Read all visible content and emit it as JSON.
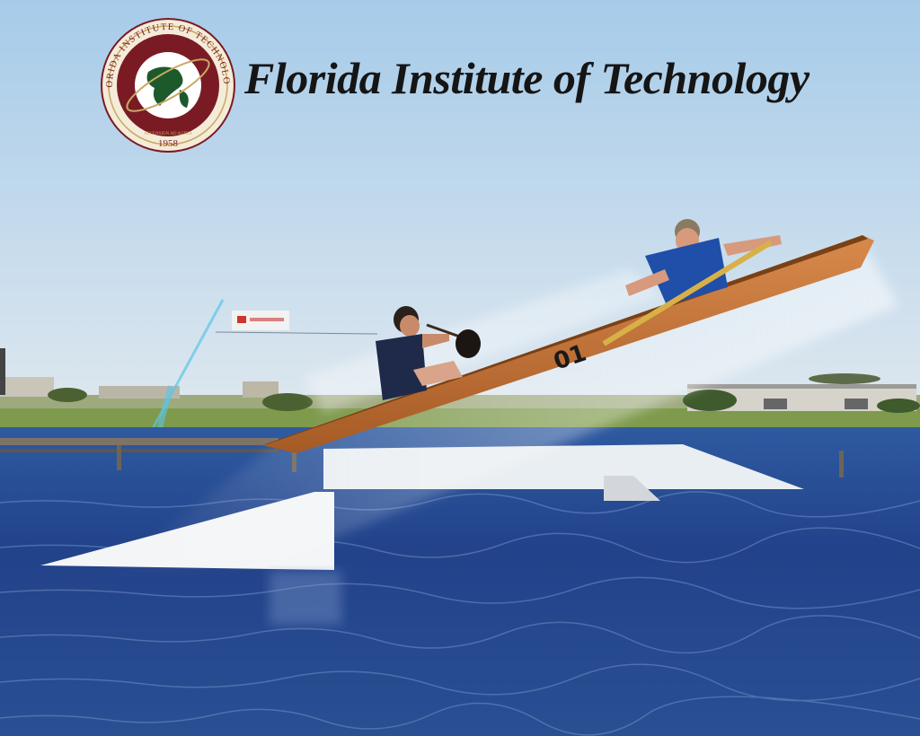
{
  "header": {
    "title": "Florida Institute of Technology"
  },
  "seal": {
    "ring_text": "FLORIDA INSTITUTE OF TECHNOLOGY",
    "year": "1958",
    "motto": "ASCENSION AD ASTRA"
  },
  "canoe": {
    "number": "01",
    "color": "#c4763a"
  },
  "colors": {
    "sky_top": "#a9cce9",
    "sky_bottom": "#dbe6ef",
    "water": "#25478a",
    "seal_red": "#7a1b24",
    "seal_gold": "#c9a862"
  }
}
